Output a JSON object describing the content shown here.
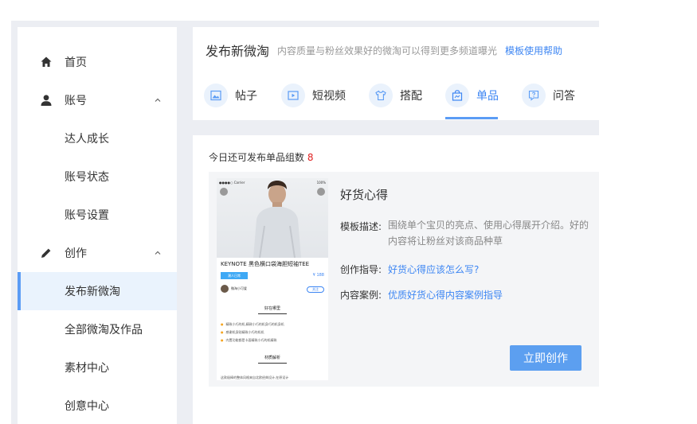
{
  "sidebar": {
    "items": [
      {
        "label": "首页",
        "icon": "home-icon"
      },
      {
        "label": "账号",
        "icon": "user-icon"
      },
      {
        "label": "达人成长"
      },
      {
        "label": "账号状态"
      },
      {
        "label": "账号设置"
      },
      {
        "label": "创作",
        "icon": "pencil-icon"
      },
      {
        "label": "发布新微淘"
      },
      {
        "label": "全部微淘及作品"
      },
      {
        "label": "素材中心"
      },
      {
        "label": "创意中心"
      }
    ]
  },
  "header": {
    "title": "发布新微淘",
    "subtitle": "内容质量与粉丝效果好的微淘可以得到更多频道曝光",
    "help_link": "模板使用帮助",
    "tabs": [
      {
        "label": "帖子"
      },
      {
        "label": "短视频"
      },
      {
        "label": "搭配"
      },
      {
        "label": "单品"
      },
      {
        "label": "问答"
      }
    ],
    "active_tab": "单品"
  },
  "content": {
    "quota_label": "今日还可发布单品组数",
    "quota_value": "8",
    "template": {
      "title": "好货心得",
      "desc_label": "模板描述:",
      "desc_value": "围绕单个宝贝的亮点、使用心得展开介绍。好的内容将让粉丝对该商品种草",
      "guide_label": "创作指导:",
      "guide_link": "好货心得应该怎么写?",
      "case_label": "内容案例:",
      "case_link": "优质好货心得内容案例指导",
      "create_button": "立即创作"
    },
    "preview": {
      "status_left": "●●●●○ Carrier",
      "status_right": "100%",
      "product_title": "KEYNOTE 黑色横口袋海胆短袖TEE",
      "badge": "潮人日常",
      "price": "¥ 188",
      "author": "微淘小可爱",
      "follow": "关注",
      "section1": "好在哪里",
      "bullets": [
        "精致小巧的机,精致小巧的机身巧的机身机",
        "感谢机身贴精致小巧的机机",
        "内置功能都是卡面精致小巧的机精致"
      ],
      "section2": "材质解析",
      "paragraph": "这款极棒的整体风格来自北欧经典设计,在原设计"
    }
  },
  "colors": {
    "accent": "#3d86f3",
    "button": "#5c9ff0",
    "quota_number": "#e02020"
  }
}
